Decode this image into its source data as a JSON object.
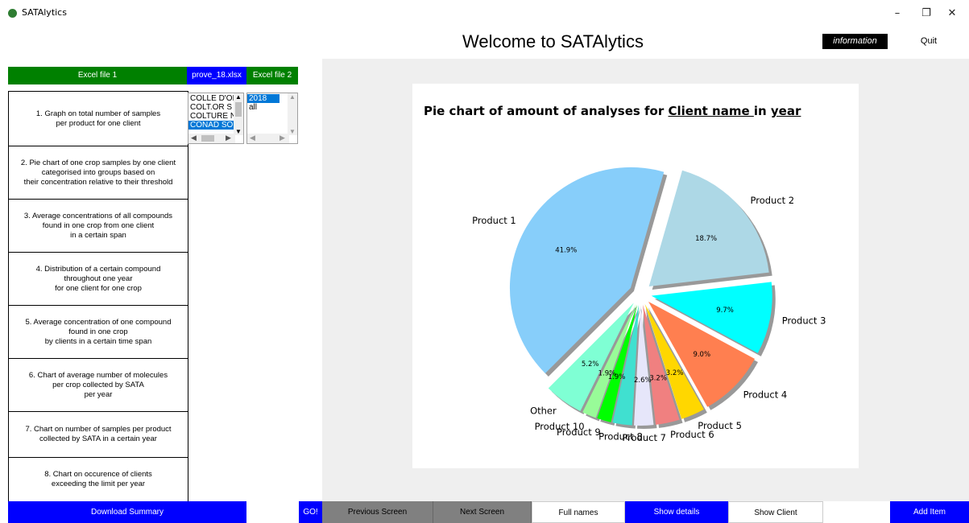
{
  "window": {
    "title": "SATAlytics",
    "minimize": "–",
    "restore": "❐",
    "close": "✕"
  },
  "header": {
    "welcome": "Welcome to SATAlytics",
    "info_label": "information",
    "quit_label": "Quit"
  },
  "files": {
    "excel1_label": "Excel file 1",
    "file_name": "prove_18.xlsx",
    "excel2_label": "Excel file 2"
  },
  "menu": [
    {
      "label": "1. Graph on total number of samples\nper product for one client"
    },
    {
      "label": "2. Pie chart of one crop samples by one client\ncategorised into groups based on\ntheir concentration relative to their threshold"
    },
    {
      "label": "3. Average concentrations of all compounds\nfound in one crop from one client\nin a certain span"
    },
    {
      "label": "4. Distribution of a certain compound\nthroughout one year\nfor one client for one crop"
    },
    {
      "label": "5. Average concentration of one compound\nfound in one crop\nby clients in a certain time span"
    },
    {
      "label": "6. Chart of average number of molecules\nper crop collected by SATA\nper year"
    },
    {
      "label": "7. Chart on number of samples per product\ncollected by SATA in a certain year"
    },
    {
      "label": "8. Chart on occurence of clients\nexceeding the limit per year"
    }
  ],
  "client_list": {
    "items": [
      "COLLE D'OI",
      "COLT.OR S",
      "COLTURE N",
      "CONAD SO"
    ],
    "selected_index": 3
  },
  "year_list": {
    "items": [
      "2018",
      "all"
    ],
    "selected_index": 0
  },
  "chart_title": {
    "prefix": "Pie chart of amount of analyses for ",
    "client": "Client name ",
    "mid": "in ",
    "year": "year"
  },
  "chart_data": {
    "type": "pie",
    "title": "Pie chart of amount of analyses for Client name in year",
    "slices": [
      {
        "label": "Product 1",
        "value": 41.9,
        "pct_label": "41.9%",
        "color": "#87cefa"
      },
      {
        "label": "Product 2",
        "value": 18.7,
        "pct_label": "18.7%",
        "color": "#add8e6"
      },
      {
        "label": "Product 3",
        "value": 9.7,
        "pct_label": "9.7%",
        "color": "#00ffff"
      },
      {
        "label": "Product 4",
        "value": 9.0,
        "pct_label": "9.0%",
        "color": "#ff7f50"
      },
      {
        "label": "Product 5",
        "value": 3.2,
        "pct_label": "3.2%",
        "color": "#ffd700"
      },
      {
        "label": "Product 6",
        "value": 3.2,
        "pct_label": "3.2%",
        "color": "#f08080"
      },
      {
        "label": "Product 7",
        "value": 2.6,
        "pct_label": "2.6%",
        "color": "#e6e6fa"
      },
      {
        "label": "Product 8",
        "value": 2.6,
        "pct_label": "",
        "color": "#40e0d0"
      },
      {
        "label": "Product 9",
        "value": 1.9,
        "pct_label": "1.9%",
        "color": "#00ff00"
      },
      {
        "label": "Product 10",
        "value": 1.9,
        "pct_label": "1.9%",
        "color": "#98fb98"
      },
      {
        "label": "Other",
        "value": 5.2,
        "pct_label": "5.2%",
        "color": "#7fffd4"
      }
    ]
  },
  "bottom": {
    "download": "Download Summary",
    "go": "GO!",
    "prev": "Previous Screen",
    "next": "Next Screen",
    "full_names": "Full names",
    "show_details": "Show details",
    "show_client": "Show Client",
    "add_item": "Add Item"
  }
}
